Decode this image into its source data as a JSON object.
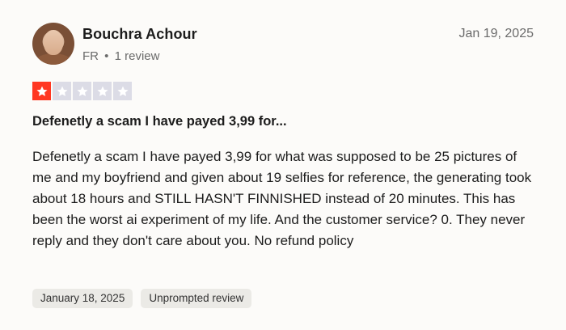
{
  "reviewer": {
    "name": "Bouchra Achour",
    "country": "FR",
    "separator": "•",
    "review_count": "1 review"
  },
  "review": {
    "date": "Jan 19, 2025",
    "rating": 1,
    "max_rating": 5,
    "title": "Defenetly a scam I have payed 3,99 for...",
    "body": "Defenetly a scam I have payed 3,99 for what was supposed to be 25 pictures of me and my boyfriend and given about 19 selfies for reference, the generating took about 18 hours and STILL HASN'T FINNISHED instead of 20 minutes. This has been the worst ai experiment of my life. And the customer service? 0. They never reply and they don't care about you. No refund policy",
    "experience_date": "January 18, 2025",
    "tag": "Unprompted review"
  },
  "colors": {
    "star_filled": "#ff3722",
    "star_empty": "#dcdce6",
    "background": "#fcfbf9"
  }
}
